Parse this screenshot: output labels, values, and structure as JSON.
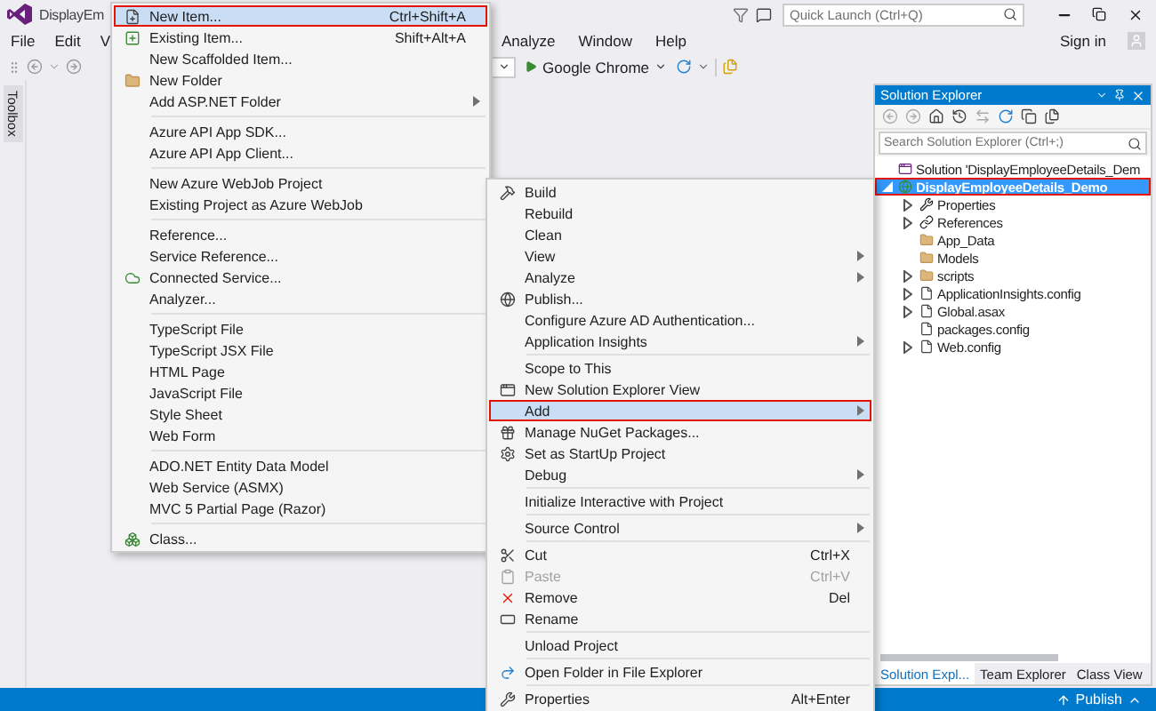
{
  "window": {
    "title": "DisplayEm"
  },
  "title_bar": {
    "quick_launch": {
      "placeholder": "Quick Launch (Ctrl+Q)"
    }
  },
  "menu_bar": {
    "left_items": [
      "File",
      "Edit",
      "V"
    ],
    "right_items": [
      "Analyze",
      "Window",
      "Help"
    ],
    "sign_in": "Sign in"
  },
  "toolbar": {
    "run_target": "Google Chrome"
  },
  "toolbox_tab": {
    "label": "Toolbox"
  },
  "add_menu": {
    "items": [
      {
        "kind": "item",
        "label": "New Item...",
        "shortcut": "Ctrl+Shift+A",
        "selected": true,
        "has_submenu": false
      },
      {
        "kind": "item",
        "label": "Existing Item...",
        "shortcut": "Shift+Alt+A",
        "selected": false,
        "has_submenu": false
      },
      {
        "kind": "item",
        "label": "New Scaffolded Item...",
        "selected": false,
        "has_submenu": false
      },
      {
        "kind": "item",
        "label": "New Folder",
        "selected": false,
        "has_submenu": false
      },
      {
        "kind": "item",
        "label": "Add ASP.NET Folder",
        "selected": false,
        "has_submenu": true
      },
      {
        "kind": "separator"
      },
      {
        "kind": "item",
        "label": "Azure API App SDK...",
        "selected": false,
        "has_submenu": false
      },
      {
        "kind": "item",
        "label": "Azure API App Client...",
        "selected": false,
        "has_submenu": false
      },
      {
        "kind": "separator"
      },
      {
        "kind": "item",
        "label": "New Azure WebJob Project",
        "selected": false,
        "has_submenu": false
      },
      {
        "kind": "item",
        "label": "Existing Project as Azure WebJob",
        "selected": false,
        "has_submenu": false
      },
      {
        "kind": "separator"
      },
      {
        "kind": "item",
        "label": "Reference...",
        "selected": false,
        "has_submenu": false
      },
      {
        "kind": "item",
        "label": "Service Reference...",
        "selected": false,
        "has_submenu": false
      },
      {
        "kind": "item",
        "label": "Connected Service...",
        "selected": false,
        "has_submenu": false
      },
      {
        "kind": "item",
        "label": "Analyzer...",
        "selected": false,
        "has_submenu": false
      },
      {
        "kind": "separator"
      },
      {
        "kind": "item",
        "label": "TypeScript File",
        "selected": false,
        "has_submenu": false
      },
      {
        "kind": "item",
        "label": "TypeScript JSX File",
        "selected": false,
        "has_submenu": false
      },
      {
        "kind": "item",
        "label": "HTML Page",
        "selected": false,
        "has_submenu": false
      },
      {
        "kind": "item",
        "label": "JavaScript File",
        "selected": false,
        "has_submenu": false
      },
      {
        "kind": "item",
        "label": "Style Sheet",
        "selected": false,
        "has_submenu": false
      },
      {
        "kind": "item",
        "label": "Web Form",
        "selected": false,
        "has_submenu": false
      },
      {
        "kind": "separator"
      },
      {
        "kind": "item",
        "label": "ADO.NET Entity Data Model",
        "selected": false,
        "has_submenu": false
      },
      {
        "kind": "item",
        "label": "Web Service (ASMX)",
        "selected": false,
        "has_submenu": false
      },
      {
        "kind": "item",
        "label": "MVC 5 Partial Page (Razor)",
        "selected": false,
        "has_submenu": false
      },
      {
        "kind": "separator"
      },
      {
        "kind": "item",
        "label": "Class...",
        "selected": false,
        "has_submenu": false
      }
    ]
  },
  "context_menu": {
    "items": [
      {
        "kind": "item",
        "label": "Build",
        "selected": false,
        "disabled": false,
        "has_submenu": false
      },
      {
        "kind": "item",
        "label": "Rebuild",
        "selected": false,
        "disabled": false,
        "has_submenu": false
      },
      {
        "kind": "item",
        "label": "Clean",
        "selected": false,
        "disabled": false,
        "has_submenu": false
      },
      {
        "kind": "item",
        "label": "View",
        "selected": false,
        "disabled": false,
        "has_submenu": true
      },
      {
        "kind": "item",
        "label": "Analyze",
        "selected": false,
        "disabled": false,
        "has_submenu": true
      },
      {
        "kind": "item",
        "label": "Publish...",
        "selected": false,
        "disabled": false,
        "has_submenu": false
      },
      {
        "kind": "item",
        "label": "Configure Azure AD Authentication...",
        "selected": false,
        "disabled": false,
        "has_submenu": false
      },
      {
        "kind": "item",
        "label": "Application Insights",
        "selected": false,
        "disabled": false,
        "has_submenu": true
      },
      {
        "kind": "separator"
      },
      {
        "kind": "item",
        "label": "Scope to This",
        "selected": false,
        "disabled": false,
        "has_submenu": false
      },
      {
        "kind": "item",
        "label": "New Solution Explorer View",
        "selected": false,
        "disabled": false,
        "has_submenu": false
      },
      {
        "kind": "item",
        "label": "Add",
        "selected": true,
        "disabled": false,
        "has_submenu": true
      },
      {
        "kind": "item",
        "label": "Manage NuGet Packages...",
        "selected": false,
        "disabled": false,
        "has_submenu": false
      },
      {
        "kind": "item",
        "label": "Set as StartUp Project",
        "selected": false,
        "disabled": false,
        "has_submenu": false
      },
      {
        "kind": "item",
        "label": "Debug",
        "selected": false,
        "disabled": false,
        "has_submenu": true
      },
      {
        "kind": "separator"
      },
      {
        "kind": "item",
        "label": "Initialize Interactive with Project",
        "selected": false,
        "disabled": false,
        "has_submenu": false
      },
      {
        "kind": "separator"
      },
      {
        "kind": "item",
        "label": "Source Control",
        "selected": false,
        "disabled": false,
        "has_submenu": true
      },
      {
        "kind": "separator"
      },
      {
        "kind": "item",
        "label": "Cut",
        "shortcut": "Ctrl+X",
        "selected": false,
        "disabled": false,
        "has_submenu": false
      },
      {
        "kind": "item",
        "label": "Paste",
        "shortcut": "Ctrl+V",
        "selected": false,
        "disabled": true,
        "has_submenu": false
      },
      {
        "kind": "item",
        "label": "Remove",
        "shortcut": "Del",
        "selected": false,
        "disabled": false,
        "has_submenu": false
      },
      {
        "kind": "item",
        "label": "Rename",
        "selected": false,
        "disabled": false,
        "has_submenu": false
      },
      {
        "kind": "separator"
      },
      {
        "kind": "item",
        "label": "Unload Project",
        "selected": false,
        "disabled": false,
        "has_submenu": false
      },
      {
        "kind": "separator"
      },
      {
        "kind": "item",
        "label": "Open Folder in File Explorer",
        "selected": false,
        "disabled": false,
        "has_submenu": false
      },
      {
        "kind": "separator"
      },
      {
        "kind": "item",
        "label": "Properties",
        "shortcut": "Alt+Enter",
        "selected": false,
        "disabled": false,
        "has_submenu": false
      }
    ]
  },
  "solution_explorer": {
    "title": "Solution Explorer",
    "search": {
      "placeholder": "Search Solution Explorer (Ctrl+;)"
    },
    "tree": [
      {
        "kind": "solution",
        "label": "Solution 'DisplayEmployeeDetails_Dem",
        "selected": false,
        "children": [
          {
            "kind": "project",
            "label": "DisplayEmployeeDetails_Demo",
            "selected": true,
            "expanded": true,
            "children": [
              {
                "kind": "properties",
                "label": "Properties",
                "selected": false,
                "expanded": false
              },
              {
                "kind": "references",
                "label": "References",
                "selected": false,
                "expanded": false
              },
              {
                "kind": "folder",
                "label": "App_Data",
                "selected": false
              },
              {
                "kind": "folder",
                "label": "Models",
                "selected": false
              },
              {
                "kind": "folder",
                "label": "scripts",
                "selected": false,
                "expanded": false
              },
              {
                "kind": "file",
                "label": "ApplicationInsights.config",
                "selected": false,
                "expanded": false
              },
              {
                "kind": "file",
                "label": "Global.asax",
                "selected": false,
                "expanded": false
              },
              {
                "kind": "file",
                "label": "packages.config",
                "selected": false
              },
              {
                "kind": "file",
                "label": "Web.config",
                "selected": false,
                "expanded": false
              }
            ]
          }
        ]
      }
    ],
    "tabs": [
      {
        "label": "Solution Expl...",
        "selected": true
      },
      {
        "label": "Team Explorer",
        "selected": false
      },
      {
        "label": "Class View",
        "selected": false
      }
    ]
  },
  "status_bar": {
    "publish": "Publish"
  }
}
